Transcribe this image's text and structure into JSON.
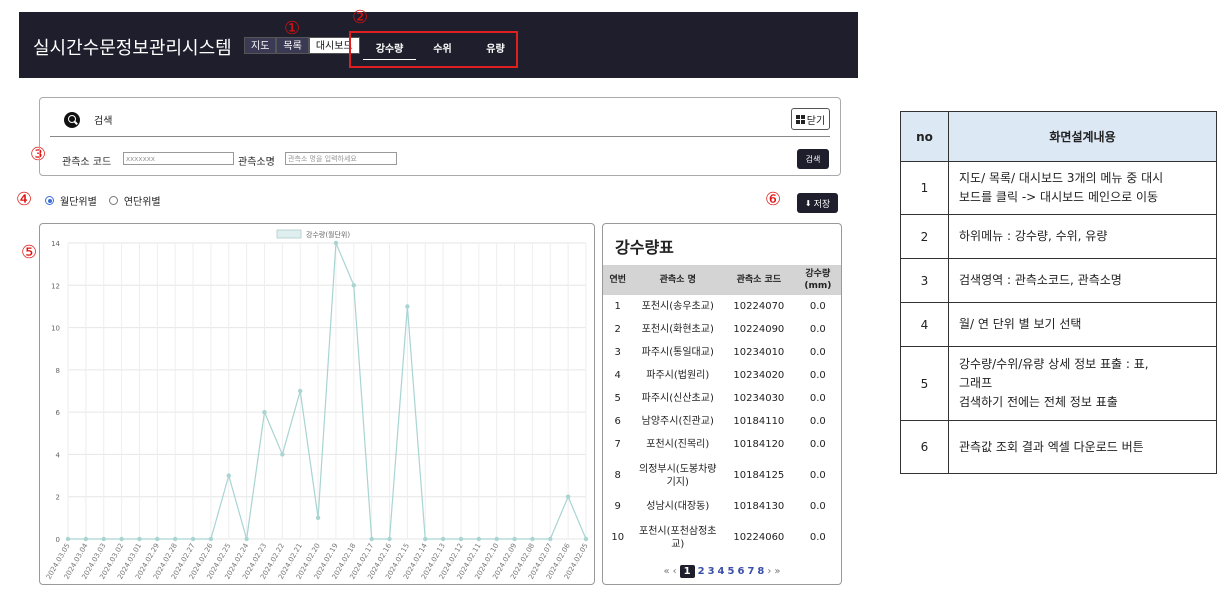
{
  "header": {
    "app_title": "실시간수문정보관리시스템",
    "main_tabs": [
      {
        "label": "지도",
        "active": false
      },
      {
        "label": "목록",
        "active": false
      },
      {
        "label": "대시보드",
        "active": true
      }
    ],
    "sub_tabs": [
      {
        "label": "강수량",
        "active": true
      },
      {
        "label": "수위",
        "active": false
      },
      {
        "label": "유량",
        "active": false
      }
    ]
  },
  "markers": {
    "m1": "①",
    "m2": "②",
    "m3": "③",
    "m4": "④",
    "m5": "⑤",
    "m6": "⑥"
  },
  "search": {
    "title": "검색",
    "close_label": "닫기",
    "code_label": "관측소 코드",
    "code_placeholder": "xxxxxxx",
    "name_label": "관측소명",
    "name_placeholder": "관측소 명을 입력하세요",
    "button_label": "검색"
  },
  "view_options": {
    "monthly": "월단위별",
    "yearly": "연단위별",
    "selected": "monthly"
  },
  "save_label": "저장",
  "chart_data": {
    "type": "line",
    "legend": "강수량(월단위)",
    "x": [
      "2024.03.05",
      "2024.03.04",
      "2024.03.03",
      "2024.03.02",
      "2024.03.01",
      "2024.02.29",
      "2024.02.28",
      "2024.02.27",
      "2024.02.26",
      "2024.02.25",
      "2024.02.24",
      "2024.02.23",
      "2024.02.22",
      "2024.02.21",
      "2024.02.20",
      "2024.02.19",
      "2024.02.18",
      "2024.02.17",
      "2024.02.16",
      "2024.02.15",
      "2024.02.14",
      "2024.02.13",
      "2024.02.12",
      "2024.02.11",
      "2024.02.10",
      "2024.02.09",
      "2024.02.08",
      "2024.02.07",
      "2024.02.06",
      "2024.02.05"
    ],
    "values": [
      0,
      0,
      0,
      0,
      0,
      0,
      0,
      0,
      0,
      3,
      0,
      6,
      4,
      7,
      1,
      14,
      12,
      0,
      0,
      11,
      0,
      0,
      0,
      0,
      0,
      0,
      0,
      0,
      2,
      0
    ],
    "ylim": [
      0,
      14
    ],
    "yticks": [
      0,
      2,
      4,
      6,
      8,
      10,
      12,
      14
    ],
    "grid": true,
    "color": "#a8d4d2"
  },
  "rain_table": {
    "title": "강수량표",
    "headers": [
      "연번",
      "관측소 명",
      "관측소 코드",
      "강수량 (mm)"
    ],
    "rows": [
      [
        "1",
        "포천시(송우초교)",
        "10224070",
        "0.0"
      ],
      [
        "2",
        "포천시(화현초교)",
        "10224090",
        "0.0"
      ],
      [
        "3",
        "파주시(통일대교)",
        "10234010",
        "0.0"
      ],
      [
        "4",
        "파주시(법원리)",
        "10234020",
        "0.0"
      ],
      [
        "5",
        "파주시(신산초교)",
        "10234030",
        "0.0"
      ],
      [
        "6",
        "남양주시(진관교)",
        "10184110",
        "0.0"
      ],
      [
        "7",
        "포천시(진목리)",
        "10184120",
        "0.0"
      ],
      [
        "8",
        "의정부시(도봉차량기지)",
        "10184125",
        "0.0"
      ],
      [
        "9",
        "성남시(대장동)",
        "10184130",
        "0.0"
      ],
      [
        "10",
        "포천시(포천삼정초교)",
        "10224060",
        "0.0"
      ]
    ],
    "pager": {
      "first": "«",
      "prev": "‹",
      "pages": [
        "1",
        "2",
        "3",
        "4",
        "5",
        "6",
        "7",
        "8"
      ],
      "current": "1",
      "next": "›",
      "last": "»"
    }
  },
  "desc_table": {
    "headers": [
      "no",
      "화면설계내용"
    ],
    "rows": [
      {
        "no": "1",
        "lines": [
          "지도/ 목록/ 대시보드 3개의 메뉴 중 대시",
          "보드를 클릭 -> 대시보드 메인으로 이동"
        ]
      },
      {
        "no": "2",
        "lines": [
          "하위메뉴 : 강수량, 수위, 유량"
        ]
      },
      {
        "no": "3",
        "lines": [
          "검색영역 : 관측소코드, 관측소명"
        ]
      },
      {
        "no": "4",
        "lines": [
          "월/ 연 단위 별 보기 선택"
        ]
      },
      {
        "no": "5",
        "lines": [
          "강수량/수위/유량  상세 정보 표출 : 표,",
          "그래프",
          "검색하기 전에는 전체 정보 표출"
        ]
      },
      {
        "no": "6",
        "lines": [
          "관측값 조회 결과 엑셀 다운로드 버튼"
        ]
      }
    ]
  }
}
